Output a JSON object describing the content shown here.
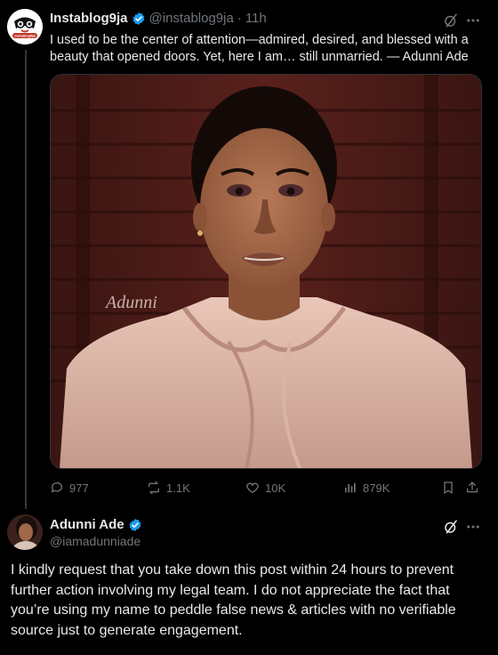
{
  "original_tweet": {
    "display_name": "Instablog9ja",
    "handle": "@instablog9ja",
    "separator": "·",
    "time": "11h",
    "text": "I used to be the center of attention—admired, desired, and blessed with a beauty that opened doors. Yet, here I am… still unmarried. — Adunni Ade",
    "avatar_label": "instablog9ja",
    "watermark": "Adunni",
    "stats": {
      "replies": "977",
      "reposts": "1.1K",
      "likes": "10K",
      "views": "879K"
    }
  },
  "reply": {
    "display_name": "Adunni Ade",
    "handle": "@iamadunniade",
    "text": "I kindly request that you take down this post within 24 hours to prevent further action involving my legal team. I do not appreciate the fact that you’re using my name to peddle false news & articles with no verifiable source just to generate engagement."
  },
  "colors": {
    "background": "#000000",
    "text": "#e7e9ea",
    "muted": "#71767b",
    "verified_blue": "#1d9bf0"
  },
  "icons": [
    "grok-icon",
    "more-icon",
    "reply-icon",
    "repost-icon",
    "like-icon",
    "views-icon",
    "bookmark-icon",
    "share-icon",
    "verified-badge-icon"
  ]
}
